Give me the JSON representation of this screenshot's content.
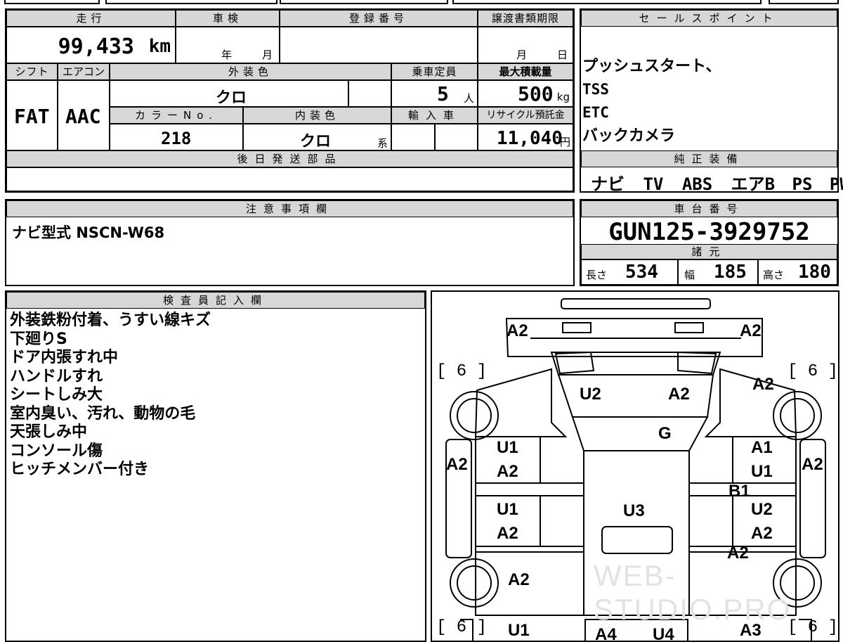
{
  "top_strip": [
    "",
    "",
    "",
    "",
    ""
  ],
  "main": {
    "mileage": {
      "label": "走行",
      "value": "99,433",
      "unit": "km"
    },
    "inspection": {
      "label": "車検",
      "year_unit": "年",
      "month_unit": "月"
    },
    "registration": {
      "label": "登録番号",
      "value": ""
    },
    "transfer_deadline": {
      "label": "譲渡書類期限",
      "month_unit": "月",
      "day_unit": "日"
    },
    "shift": {
      "label": "シフト",
      "value": "FAT"
    },
    "aircon": {
      "label": "エアコン",
      "value": "AAC"
    },
    "exterior_color": {
      "label": "外装色",
      "value": "クロ"
    },
    "capacity": {
      "label": "乗車定員",
      "value": "5",
      "unit": "人"
    },
    "max_load": {
      "label": "最大積載量",
      "value": "500",
      "unit": "kg"
    },
    "color_no": {
      "label": "カラーNo.",
      "value": "218"
    },
    "interior_color": {
      "label": "内装色",
      "value": "クロ",
      "suffix": "系"
    },
    "import": {
      "label": "輸入車"
    },
    "recycle": {
      "label": "リサイクル預託金",
      "value": "11,040",
      "unit": "円"
    },
    "later_parts": {
      "label": "後日発送部品",
      "value": ""
    }
  },
  "sales_points": {
    "label": "セールスポイント",
    "items": [
      "プッシュスタート、",
      "TSS",
      "ETC",
      "バックカメラ"
    ]
  },
  "genuine_equipment": {
    "label": "純正装備",
    "items": [
      "ナビ",
      "TV",
      "ABS",
      "エアB",
      "PS",
      "PW"
    ]
  },
  "caution": {
    "label": "注意事項欄",
    "text": "ナビ型式 NSCN-W68"
  },
  "chassis": {
    "label": "車台番号",
    "value": "GUN125-3929752"
  },
  "specs": {
    "label": "諸元",
    "length_label": "長さ",
    "length": "534",
    "width_label": "幅",
    "width": "185",
    "height_label": "高さ",
    "height": "180"
  },
  "inspector": {
    "label": "検査員記入欄",
    "lines": [
      "外装鉄粉付着、うすい線キズ",
      "下廻りS",
      "ドア内張すれ中",
      "ハンドルすれ",
      "シートしみ大",
      "室内臭い、汚れ、動物の毛",
      "天張しみ中",
      "コンソール傷",
      "ヒッチメンバー付き"
    ]
  },
  "diagram": {
    "brackets": [
      "[ 6 ]",
      "[ 6 ]",
      "[ 6 ]",
      "[ 6 ]"
    ],
    "marks": {
      "front_left": "A2",
      "front_right": "A2",
      "hood_left": "U2",
      "hood_right": "A2",
      "front_fender_right": "A2",
      "windshield": "G",
      "fl_door_1": "U1",
      "fl_door_2": "A2",
      "fr_door_1": "A1",
      "fr_door_2": "U1",
      "left_side": "A2",
      "right_side": "A2",
      "pillar_right": "B1",
      "rl_door_1": "U1",
      "rl_door_2": "A2",
      "rr_door_1": "U2",
      "rr_door_2": "A2",
      "roof": "U3",
      "rear_right": "A2",
      "rear_fender_left": "A2",
      "bottom_left": "U1",
      "bottom_mid_1": "A4",
      "bottom_mid_2": "U4",
      "bottom_right": "A3"
    },
    "watermark": "WEB-STUDIO.PRO"
  }
}
